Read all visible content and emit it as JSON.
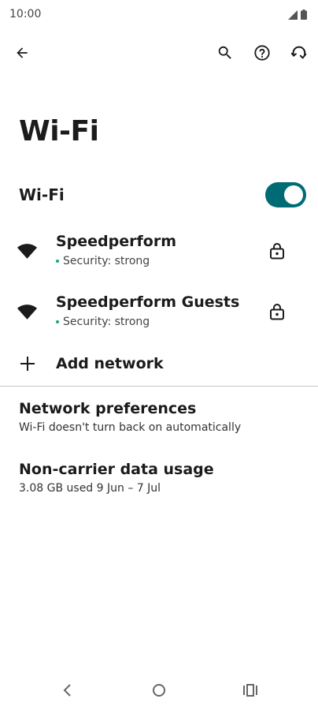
{
  "status_bar": {
    "time": "10:00",
    "icons": [
      "signal-icon",
      "battery-icon"
    ]
  },
  "app_bar": {
    "back_icon": "arrow-back-icon",
    "actions": [
      "search-icon",
      "help-icon",
      "reset-network-icon"
    ]
  },
  "page_title": "Wi-Fi",
  "wifi_toggle": {
    "label": "Wi-Fi",
    "on": true,
    "accent_color": "#006b75"
  },
  "networks": [
    {
      "name": "Speedperform",
      "security": "Security: strong",
      "locked": true
    },
    {
      "name": "Speedperform Guests",
      "security": "Security: strong",
      "locked": true
    }
  ],
  "add_network": {
    "label": "Add network"
  },
  "preferences": [
    {
      "title": "Network preferences",
      "subtitle": "Wi-Fi doesn't turn back on automatically"
    },
    {
      "title": "Non-carrier data usage",
      "subtitle": "3.08 GB used 9 Jun – 7 Jul"
    }
  ],
  "nav_bar": [
    "back-nav-icon",
    "home-nav-icon",
    "recents-nav-icon"
  ]
}
